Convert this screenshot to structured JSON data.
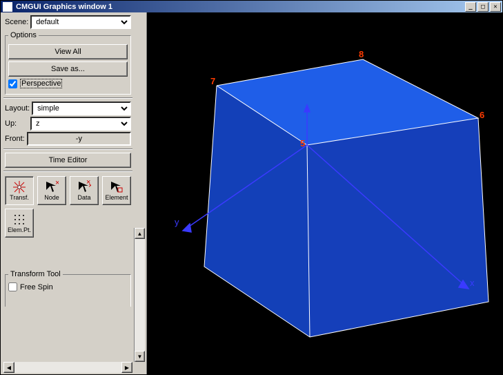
{
  "window": {
    "title": "CMGUI Graphics window 1",
    "min_glyph": "_",
    "max_glyph": "□",
    "close_glyph": "✕"
  },
  "scene": {
    "label": "Scene:",
    "value": "default"
  },
  "options": {
    "legend": "Options",
    "view_all": "View All",
    "save_as": "Save as...",
    "perspective_label": "Perspective",
    "perspective_checked": true
  },
  "layout": {
    "label": "Layout:",
    "value": "simple"
  },
  "up": {
    "label": "Up:",
    "value": "z"
  },
  "front": {
    "label": "Front:",
    "value": "-y"
  },
  "time_editor": "Time Editor",
  "tools": [
    {
      "id": "transf",
      "label": "Transf.",
      "selected": true
    },
    {
      "id": "node",
      "label": "Node",
      "selected": false
    },
    {
      "id": "data",
      "label": "Data",
      "selected": false
    },
    {
      "id": "element",
      "label": "Element",
      "selected": false
    },
    {
      "id": "elempt",
      "label": "Elem.Pt.",
      "selected": false
    }
  ],
  "transform_tool": {
    "legend": "Transform Tool",
    "free_spin_label": "Free Spin",
    "free_spin_checked": false
  },
  "scrollbar": {
    "up_glyph": "▲",
    "down_glyph": "▼",
    "left_glyph": "◀",
    "right_glyph": "▶"
  },
  "viewport": {
    "axes": {
      "x": "x",
      "y": "y",
      "z": ""
    },
    "node_labels": {
      "n5": "5",
      "n6": "6",
      "n7": "7",
      "n8": "8"
    },
    "cube_color": "#1a4fd6",
    "cube_top_color": "#1e5de8",
    "cube_side_color": "#153db0",
    "edge_color": "#ffffff"
  }
}
